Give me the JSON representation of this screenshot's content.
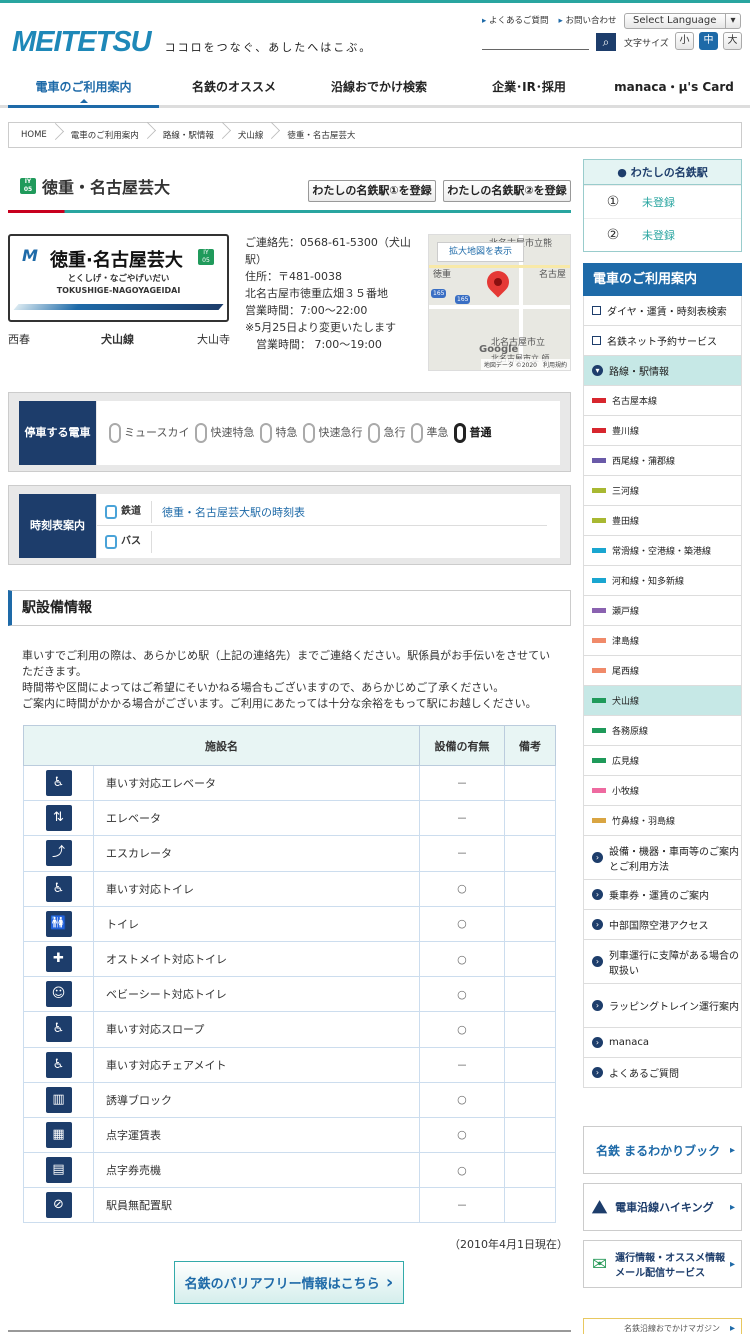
{
  "header": {
    "logo": "MEITETSU",
    "tagline": "ココロをつなぐ、あしたへはこぶ。",
    "links": [
      "よくあるご質問",
      "お問い合わせ"
    ],
    "language": "Select Language",
    "font_size_label": "文字サイズ",
    "font_sizes": [
      "小",
      "中",
      "大"
    ]
  },
  "gnav": [
    "電車のご利用案内",
    "名鉄のオススメ",
    "沿線おでかけ検索",
    "企業･IR･採用",
    "manaca・μ's Card"
  ],
  "breadcrumb": [
    "HOME",
    "電車のご利用案内",
    "路線・駅情報",
    "犬山線",
    "徳重・名古屋芸大"
  ],
  "station": {
    "title": "徳重・名古屋芸大",
    "number_top": "IY",
    "number": "05",
    "register1": "わたしの名鉄駅①を登録",
    "register2": "わたしの名鉄駅②を登録",
    "plate_name": "徳重·名古屋芸大",
    "plate_kana": "とくしげ・なごやげいだい",
    "plate_roman": "TOKUSHIGE-NAGOYAGEIDAI",
    "prev": "西春",
    "line": "犬山線",
    "next": "大山寺"
  },
  "contact": [
    "ご連絡先：0568-61-5300（犬山駅）",
    "住所：〒481-0038",
    "北名古屋市徳重広畑３５番地",
    "営業時間：7:00～22:00",
    "※5月25日より変更いたします",
    "　営業時間： 7:00～19:00"
  ],
  "map": {
    "button": "拡大地図を表示",
    "labels": [
      "北名古屋市立熊",
      "徳重",
      "名古屋",
      "北名古屋市立",
      "北名古屋市立 師"
    ],
    "google": "Google",
    "attr": "地図データ ©2020　利用規約",
    "routes": [
      "165",
      "165"
    ]
  },
  "stops": {
    "header": "停車する電車",
    "items": [
      "ミュースカイ",
      "快速特急",
      "特急",
      "快速急行",
      "急行",
      "準急",
      "普通"
    ]
  },
  "timetable": {
    "header": "時刻表案内",
    "rail_label": "鉄道",
    "rail_link": "徳重・名古屋芸大駅の時刻表",
    "bus_label": "バス"
  },
  "facility": {
    "heading": "駅設備情報",
    "notes": [
      "車いすでご利用の際は、あらかじめ駅（上記の連絡先）までご連絡ください。駅係員がお手伝いをさせていただきます。",
      "時間帯や区間によってはご希望にそいかねる場合もございますので、あらかじめご了承ください。",
      "ご案内に時間がかかる場合がございます。ご利用にあたっては十分な余裕をもって駅にお越しください。"
    ],
    "columns": [
      "施設名",
      "設備の有無",
      "備考"
    ],
    "rows": [
      {
        "icon": "♿",
        "name": "車いす対応エレベータ",
        "has": "－"
      },
      {
        "icon": "⇅",
        "name": "エレベータ",
        "has": "－"
      },
      {
        "icon": "⤴",
        "name": "エスカレータ",
        "has": "－"
      },
      {
        "icon": "♿",
        "name": "車いす対応トイレ",
        "has": "○"
      },
      {
        "icon": "🚻",
        "name": "トイレ",
        "has": "○"
      },
      {
        "icon": "✚",
        "name": "オストメイト対応トイレ",
        "has": "○"
      },
      {
        "icon": "☺",
        "name": "ベビーシート対応トイレ",
        "has": "○"
      },
      {
        "icon": "♿",
        "name": "車いす対応スロープ",
        "has": "○"
      },
      {
        "icon": "♿",
        "name": "車いす対応チェアメイト",
        "has": "－"
      },
      {
        "icon": "▥",
        "name": "誘導ブロック",
        "has": "○"
      },
      {
        "icon": "▦",
        "name": "点字運賃表",
        "has": "○"
      },
      {
        "icon": "▤",
        "name": "点字券売機",
        "has": "○"
      },
      {
        "icon": "⊘",
        "name": "駅員無配置駅",
        "has": "－"
      }
    ],
    "as_of": "（2010年4月1日現在）",
    "barrier_free": "名鉄のバリアフリー情報はこちら"
  },
  "sidebar": {
    "my_title": "わたしの名鉄駅",
    "my_rows": [
      {
        "n": "①",
        "v": "未登録"
      },
      {
        "n": "②",
        "v": "未登録"
      }
    ],
    "menu_title": "電車のご利用案内",
    "menu": [
      {
        "label": "ダイヤ・運賃・時刻表検索",
        "type": "sq"
      },
      {
        "label": "名鉄ネット予約サービス",
        "type": "sq"
      },
      {
        "label": "路線・駅情報",
        "type": "open"
      },
      {
        "label": "名古屋本線",
        "type": "line",
        "color": "#d7262e"
      },
      {
        "label": "豊川線",
        "type": "line",
        "color": "#d7262e"
      },
      {
        "label": "西尾線・蒲郡線",
        "type": "line",
        "color": "#6a5aa8"
      },
      {
        "label": "三河線",
        "type": "line",
        "color": "#a8b832"
      },
      {
        "label": "豊田線",
        "type": "line",
        "color": "#a8b832"
      },
      {
        "label": "常滑線・空港線・築港線",
        "type": "line",
        "color": "#1aa6d0"
      },
      {
        "label": "河和線・知多新線",
        "type": "line",
        "color": "#1aa6d0"
      },
      {
        "label": "瀬戸線",
        "type": "line",
        "color": "#8a62b0"
      },
      {
        "label": "津島線",
        "type": "line",
        "color": "#f08a6a"
      },
      {
        "label": "尾西線",
        "type": "line",
        "color": "#f08a6a"
      },
      {
        "label": "犬山線",
        "type": "line",
        "color": "#1f9a5a",
        "active": true
      },
      {
        "label": "各務原線",
        "type": "line",
        "color": "#1f9a5a"
      },
      {
        "label": "広見線",
        "type": "line",
        "color": "#1f9a5a"
      },
      {
        "label": "小牧線",
        "type": "line",
        "color": "#ee6aa0"
      },
      {
        "label": "竹鼻線・羽島線",
        "type": "line",
        "color": "#d9a542"
      },
      {
        "label": "設備・機器・車両等のご案内とご利用方法",
        "type": "arr",
        "h": 44
      },
      {
        "label": "乗車券・運賃のご案内",
        "type": "arr"
      },
      {
        "label": "中部国際空港アクセス",
        "type": "arr"
      },
      {
        "label": "列車運行に支障がある場合の取扱い",
        "type": "arr",
        "h": 44
      },
      {
        "label": "ラッピングトレイン運行案内",
        "type": "arr",
        "h": 44
      },
      {
        "label": "manaca",
        "type": "arr"
      },
      {
        "label": "よくあるご質問",
        "type": "arr"
      }
    ],
    "banners": [
      "名鉄 まるわかりブック",
      "電車沿線ハイキング",
      "運行情報・オススメ情報 メール配信サービス",
      "名鉄沿線おでかけマガジン"
    ]
  }
}
